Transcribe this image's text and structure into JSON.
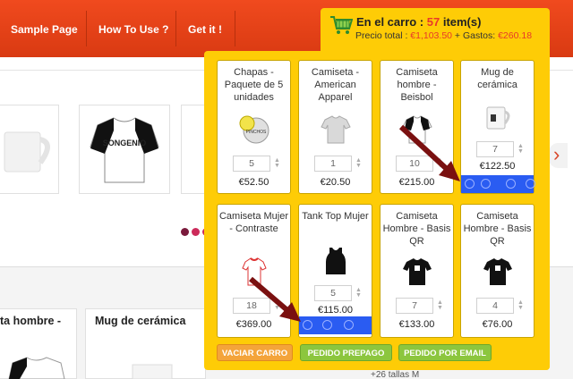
{
  "nav": {
    "items": [
      "Sample Page",
      "How To Use ?",
      "Get it !"
    ]
  },
  "background": {
    "card_titles": [
      "ta hombre -",
      "Mug de cerámica"
    ],
    "side_text": "+26 tallas M"
  },
  "cart": {
    "title_prefix": "En el carro : ",
    "count": "57",
    "title_suffix": " item(s)",
    "total_label": "Precio total : ",
    "total_value": "€1,103.50",
    "shipping_label": " + Gastos: ",
    "shipping_value": "€260.18",
    "products": [
      {
        "name": "Chapas - Paquete de 5 unidades",
        "qty": "5",
        "price": "€52.50"
      },
      {
        "name": "Camiseta - American Apparel",
        "qty": "1",
        "price": "€20.50"
      },
      {
        "name": "Camiseta hombre - Beisbol",
        "qty": "10",
        "price": "€215.00"
      },
      {
        "name": "Mug de cerámica",
        "qty": "7",
        "price": "€122.50"
      },
      {
        "name": "Camiseta Mujer - Contraste",
        "qty": "18",
        "price": "€369.00"
      },
      {
        "name": "Tank Top Mujer",
        "qty": "5",
        "price": "€115.00"
      },
      {
        "name": "Camiseta Hombre - Basis QR",
        "qty": "7",
        "price": "€133.00"
      },
      {
        "name": "Camiseta Hombre - Basis QR",
        "qty": "4",
        "price": "€76.00"
      }
    ],
    "buttons": {
      "empty": "VACIAR CARRO",
      "prepaid": "PEDIDO PREPAGO",
      "email": "PEDIDO POR EMAIL"
    }
  },
  "colors": {
    "nav_bg": "#e2421a",
    "cart_bg": "#fecc06",
    "accent_red": "#e8392a",
    "blue_bar": "#2a5cf2",
    "green_btn": "#8cc63e",
    "orange_btn": "#f4a43a",
    "arrow": "#7a1010"
  }
}
